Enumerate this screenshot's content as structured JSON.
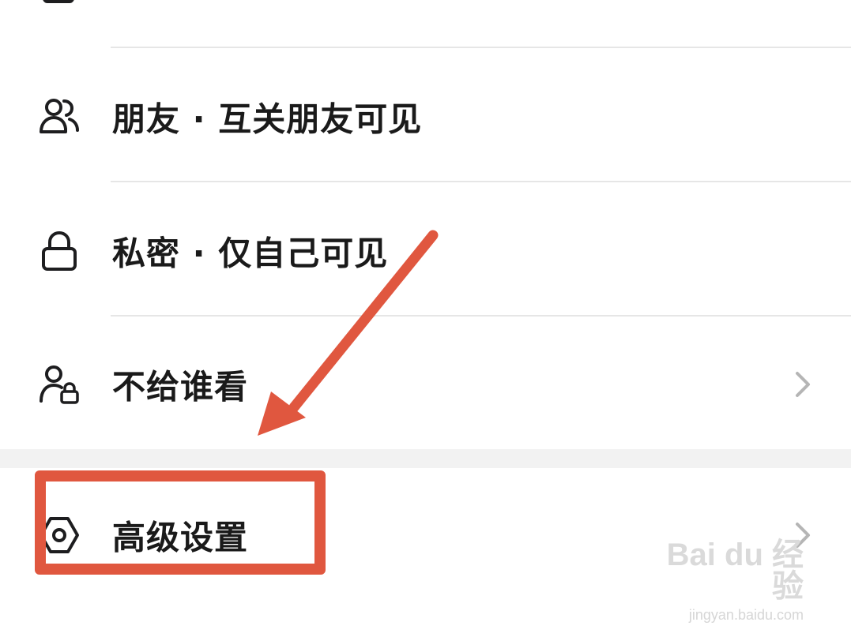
{
  "options": [
    {
      "id": "friends",
      "label": "朋友 · 互关朋友可见",
      "icon": "two-users-icon",
      "has_chevron": false
    },
    {
      "id": "private",
      "label": "私密 · 仅自己可见",
      "icon": "lock-icon",
      "has_chevron": false
    },
    {
      "id": "hide_from",
      "label": "不给谁看",
      "icon": "user-lock-icon",
      "has_chevron": true
    }
  ],
  "advanced": {
    "label": "高级设置",
    "icon": "hexagon-gear-icon",
    "has_chevron": true
  },
  "annotation": {
    "color": "#e0573f"
  },
  "watermark": {
    "logo": "Bai du 经验",
    "url": "jingyan.baidu.com"
  },
  "colors": {
    "text": "#1a1a1a",
    "divider": "#e6e6e6",
    "section_gap": "#f2f2f2",
    "chevron": "#b5b5b5"
  }
}
